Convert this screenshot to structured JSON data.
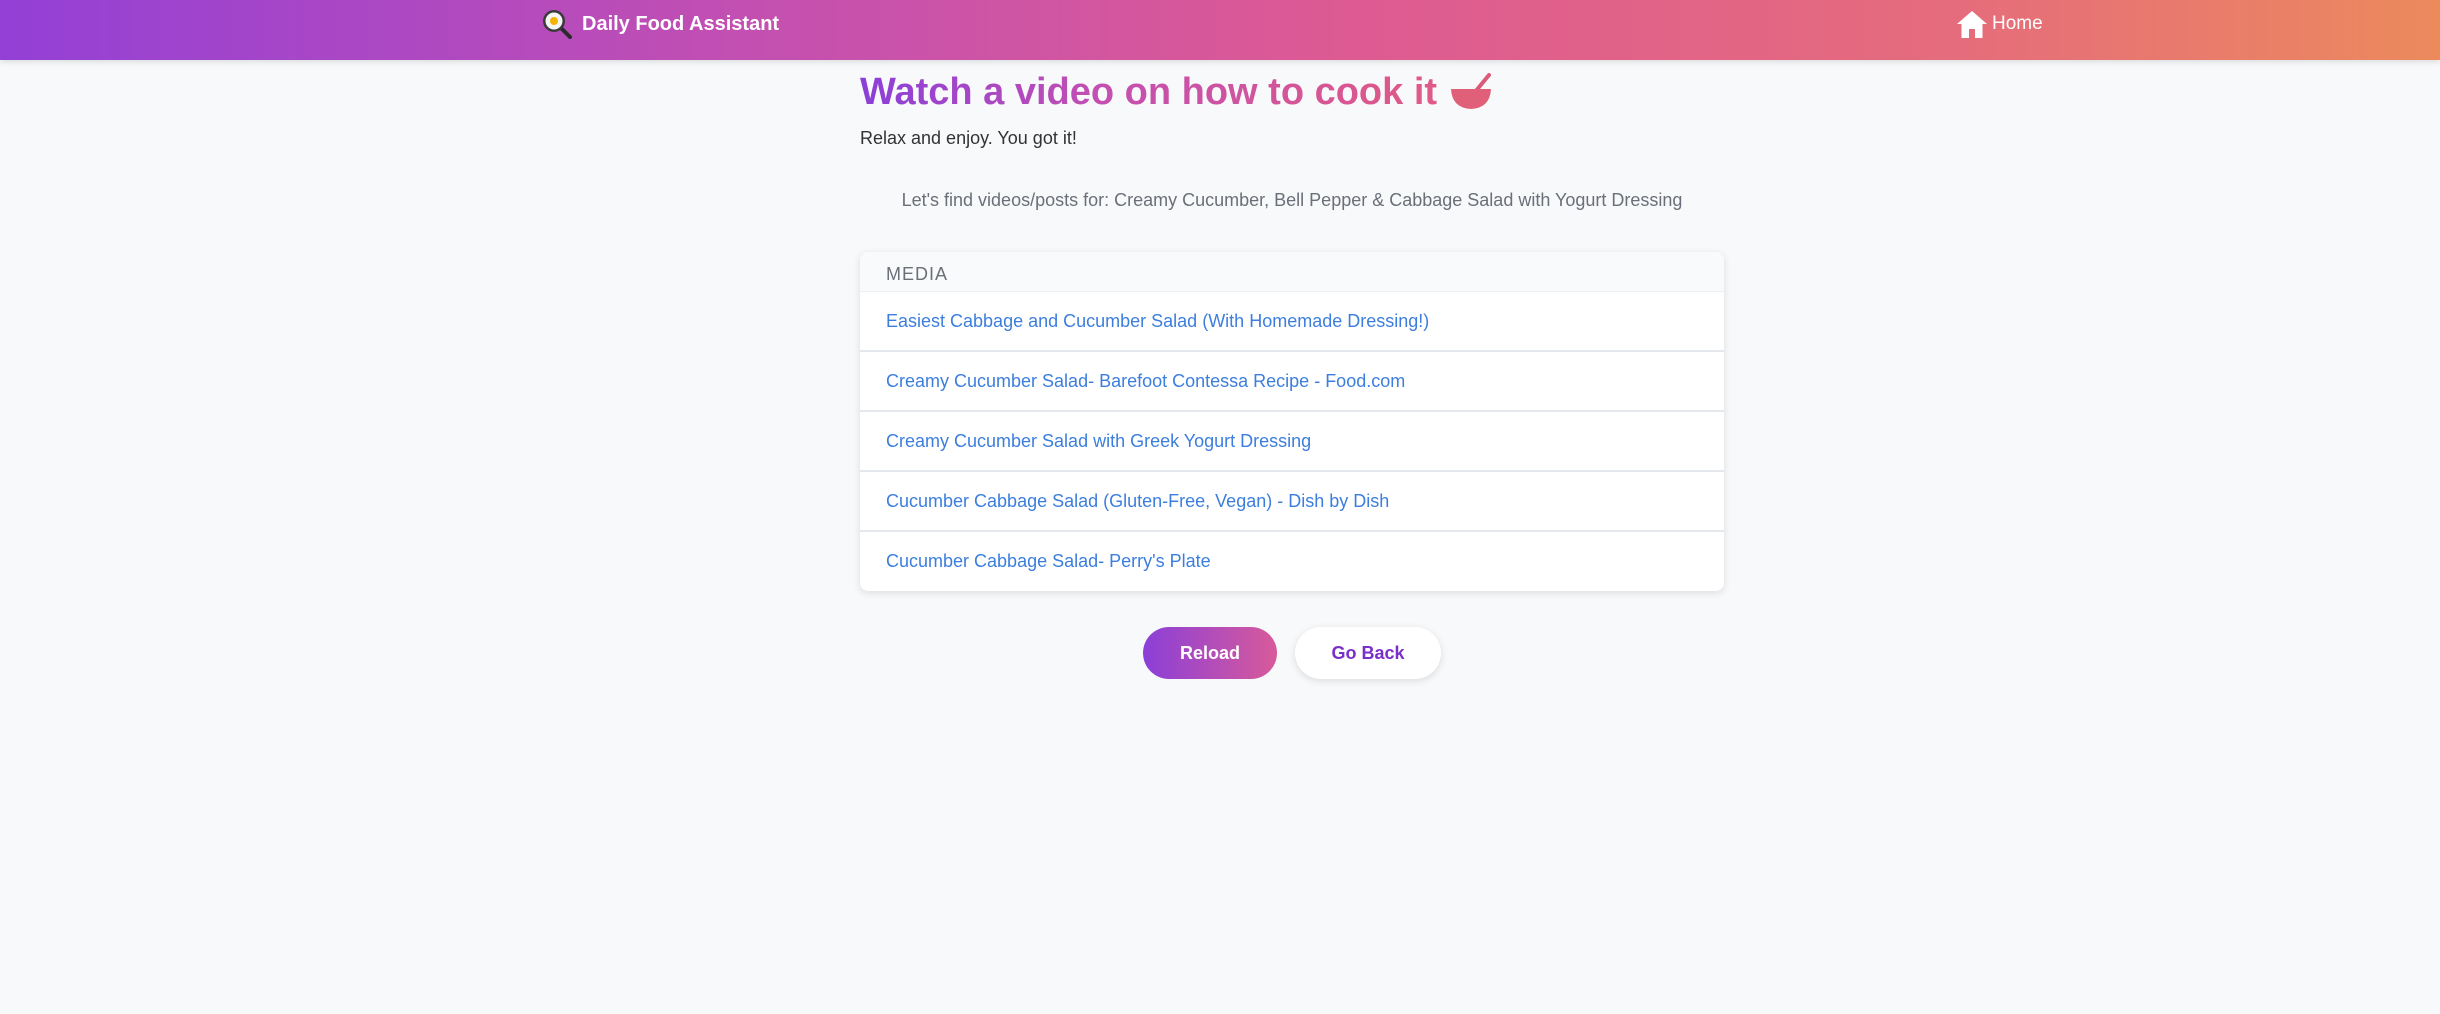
{
  "navbar": {
    "brand": "Daily Food Assistant",
    "brand_icon": "frying-pan-egg-icon",
    "home_label": "Home",
    "home_icon": "house-icon",
    "gradient": [
      "#9340d6",
      "#c24fb2",
      "#dd5a93",
      "#ec8a5c"
    ]
  },
  "main": {
    "title": "Watch a video on how to cook it",
    "title_icon": "bowl-with-spoon-icon",
    "subtitle": "Relax and enjoy. You got it!",
    "query_label": "Let's find videos/posts for:",
    "query_value": "Creamy Cucumber, Bell Pepper & Cabbage Salad with Yogurt Dressing"
  },
  "media": {
    "header": "MEDIA",
    "items": [
      {
        "label": "Easiest Cabbage and Cucumber Salad (With Homemade Dressing!)"
      },
      {
        "label": "Creamy Cucumber Salad- Barefoot Contessa Recipe - Food.com"
      },
      {
        "label": "Creamy Cucumber Salad with Greek Yogurt Dressing"
      },
      {
        "label": "Cucumber Cabbage Salad (Gluten-Free, Vegan) - Dish by Dish"
      },
      {
        "label": "Cucumber Cabbage Salad- Perry's Plate"
      }
    ],
    "link_color": "#3c7ede"
  },
  "actions": {
    "reload_label": "Reload",
    "back_label": "Go Back"
  }
}
